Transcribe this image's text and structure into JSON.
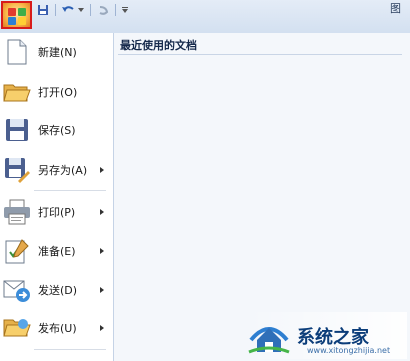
{
  "titlebar": {
    "office_button": "office-button",
    "qat": {
      "save": "save-icon",
      "undo": "undo-icon",
      "redo": "redo-icon",
      "customize": "qat-customize-icon"
    },
    "title_partial": "图"
  },
  "left_menu": {
    "items": [
      {
        "label": "新建(N)",
        "icon": "new-document-icon",
        "submenu": false
      },
      {
        "label": "打开(O)",
        "icon": "open-folder-icon",
        "submenu": false
      },
      {
        "label": "保存(S)",
        "icon": "save-disk-icon",
        "submenu": false
      },
      {
        "label": "另存为(A)",
        "icon": "save-as-icon",
        "submenu": true
      },
      {
        "label": "打印(P)",
        "icon": "printer-icon",
        "submenu": true
      },
      {
        "label": "准备(E)",
        "icon": "prepare-icon",
        "submenu": true
      },
      {
        "label": "发送(D)",
        "icon": "send-icon",
        "submenu": true
      },
      {
        "label": "发布(U)",
        "icon": "publish-icon",
        "submenu": true
      }
    ]
  },
  "right_pane": {
    "header": "最近使用的文档"
  },
  "watermark": {
    "text": "系统之家",
    "sub": "www.xitongzhijia.net"
  }
}
